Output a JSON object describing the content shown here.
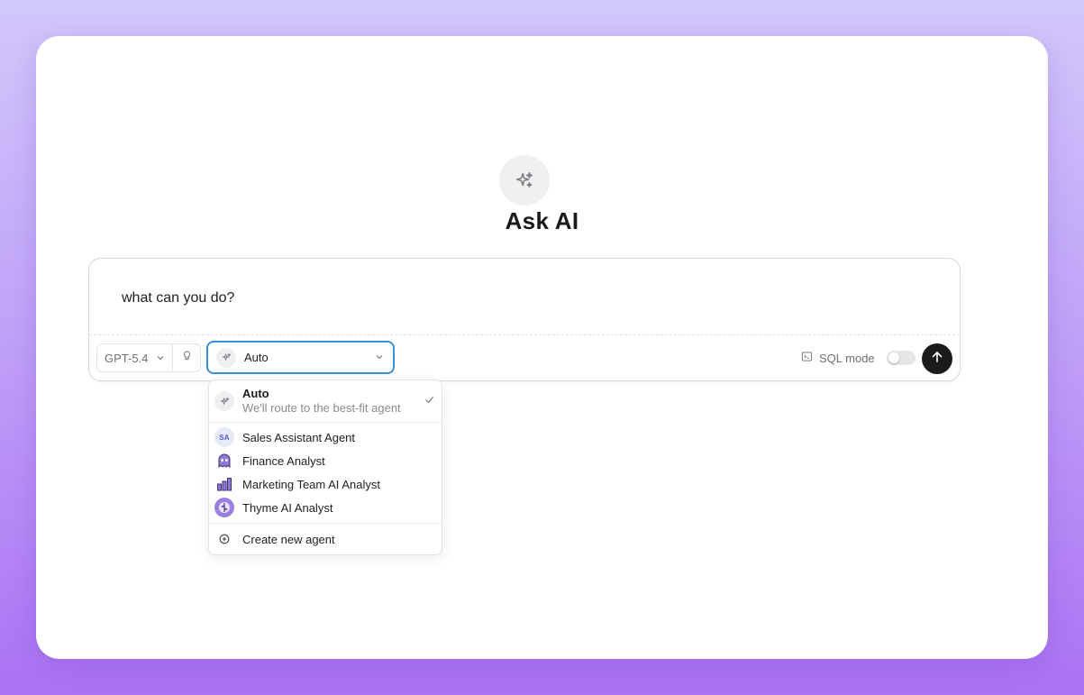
{
  "hero": {
    "icon": "sparkles-icon",
    "title": "Ask AI"
  },
  "composer": {
    "prompt": "what can you do?",
    "model": "GPT-5.4",
    "thinking_icon": "lightbulb-icon",
    "agent_selected": "Auto",
    "sql_mode_label": "SQL mode",
    "sql_mode_on": false,
    "send_icon": "arrow-up-icon"
  },
  "dropdown": {
    "auto": {
      "title": "Auto",
      "subtitle": "We'll route to the best-fit agent",
      "checked": true
    },
    "agents": [
      {
        "label": "Sales Assistant Agent",
        "avatar_text": "SA"
      },
      {
        "label": "Finance Analyst",
        "avatar": "ghost-avatar"
      },
      {
        "label": "Marketing Team AI Analyst",
        "avatar": "bar-chart-avatar"
      },
      {
        "label": "Thyme AI Analyst",
        "avatar": "thyme-avatar"
      }
    ],
    "create": {
      "label": "Create new agent",
      "icon": "plus-circle-icon"
    }
  },
  "colors": {
    "accent_border": "#3b8fd6",
    "send_button": "#1a1a1a",
    "background_top": "#d2c8fb",
    "background_bottom": "#ac72f4"
  }
}
